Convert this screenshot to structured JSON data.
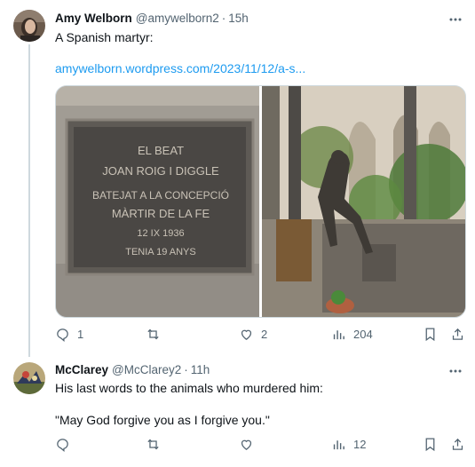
{
  "tweets": [
    {
      "author_name": "Amy Welborn",
      "handle": "@amywelborn2",
      "separator": "·",
      "time": "15h",
      "text": "A Spanish martyr:",
      "link": "amywelborn.wordpress.com/2023/11/12/a-s...",
      "plaque_lines": [
        "EL BEAT",
        "JOAN ROIG I DIGGLE",
        "BATEJAT A LA CONCEPCIÓ",
        "MÀRTIR DE LA FE",
        "12 IX 1936",
        "TENIA 19 ANYS"
      ],
      "counts": {
        "replies": "1",
        "retweets": "",
        "likes": "2",
        "views": "204"
      }
    },
    {
      "author_name": "McClarey",
      "handle": "@McClarey2",
      "separator": "·",
      "time": "11h",
      "text_line1": "His last words to the animals who murdered him:",
      "text_line2": "\"May God forgive you as I forgive you.\"",
      "counts": {
        "replies": "",
        "retweets": "",
        "likes": "",
        "views": "12"
      }
    }
  ],
  "colors": {
    "link": "#1d9bf0",
    "secondary": "#536471",
    "divider": "#eff3f4"
  },
  "icons": [
    "more-icon",
    "reply-icon",
    "retweet-icon",
    "like-icon",
    "views-icon",
    "bookmark-icon",
    "share-icon"
  ]
}
